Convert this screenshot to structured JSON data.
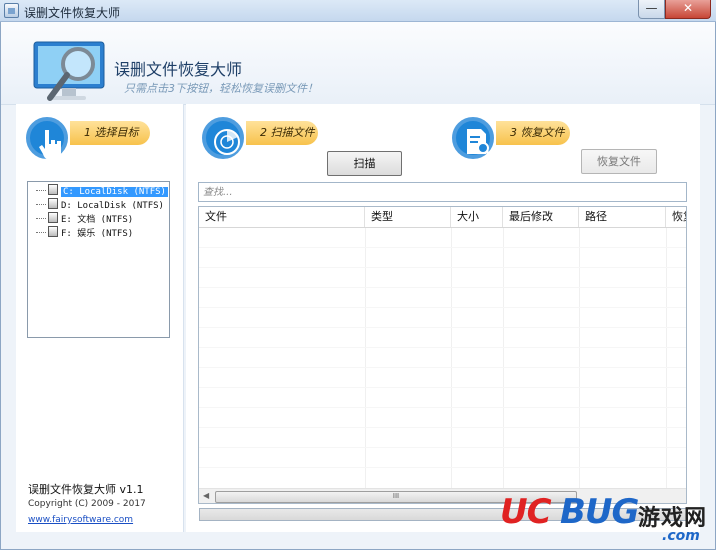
{
  "window": {
    "title": "误删文件恢复大师"
  },
  "header": {
    "title": "误删文件恢复大师",
    "subtitle": "只需点击3下按钮，轻松恢复误删文件！"
  },
  "steps": [
    {
      "label": "1 选择目标"
    },
    {
      "label": "2 扫描文件"
    },
    {
      "label": "3 恢复文件"
    }
  ],
  "buttons": {
    "scan": "扫描",
    "recover": "恢复文件"
  },
  "drives": [
    {
      "label": "C: LocalDisk (NTFS)",
      "selected": true
    },
    {
      "label": "D: LocalDisk (NTFS)",
      "selected": false
    },
    {
      "label": "E: 文档 (NTFS)",
      "selected": false
    },
    {
      "label": "F: 娱乐 (NTFS)",
      "selected": false
    }
  ],
  "search": {
    "placeholder": "查找..."
  },
  "table": {
    "columns": [
      "文件",
      "类型",
      "大小",
      "最后修改",
      "路径",
      "恢复"
    ]
  },
  "footer": {
    "app_name": "误删文件恢复大师 v1.1",
    "copyright": "Copyright (C) 2009 - 2017",
    "link": "www.fairysoftware.com"
  },
  "scrollbar": {
    "grip": "III"
  },
  "watermark": {
    "brand_red": "UC",
    "brand_blue": "BUG",
    "cn": "游戏网",
    "domain": ".com"
  },
  "colors": {
    "accent_blue": "#1f86d8",
    "step_pill": "#f7c24c",
    "selection": "#3399ff"
  }
}
